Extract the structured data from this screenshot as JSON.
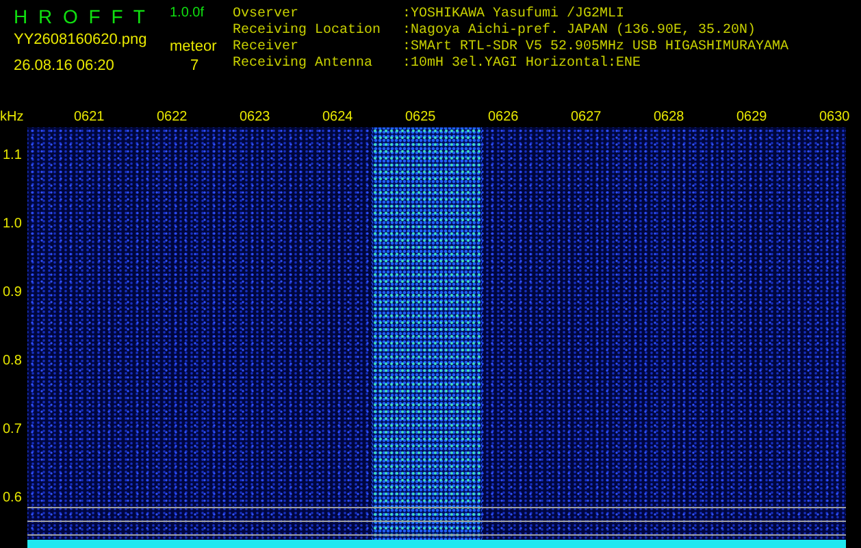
{
  "header": {
    "title": "H R O F F T",
    "version": "1.0.0f",
    "filename": "YY2608160620.png",
    "datetime": "26.08.16 06:20",
    "event_label": "meteor",
    "event_count": "7"
  },
  "station": [
    {
      "label": "Ovserver",
      "value": ":YOSHIKAWA Yasufumi /JG2MLI"
    },
    {
      "label": "Receiving Location",
      "value": ":Nagoya Aichi-pref. JAPAN (136.90E, 35.20N)"
    },
    {
      "label": "Receiver",
      "value": ":SMArt RTL-SDR V5 52.905MHz USB HIGASHIMURAYAMA"
    },
    {
      "label": "Receiving Antenna",
      "value": ":10mH 3el.YAGI Horizontal:ENE"
    }
  ],
  "spectrogram": {
    "unit": "kHz",
    "time_labels": [
      "0621",
      "0622",
      "0623",
      "0624",
      "0625",
      "0626",
      "0627",
      "0628",
      "0629",
      "0630"
    ],
    "freq_labels": [
      "1.1",
      "1.0",
      "0.9",
      "0.8",
      "0.7",
      "0.6"
    ]
  }
}
